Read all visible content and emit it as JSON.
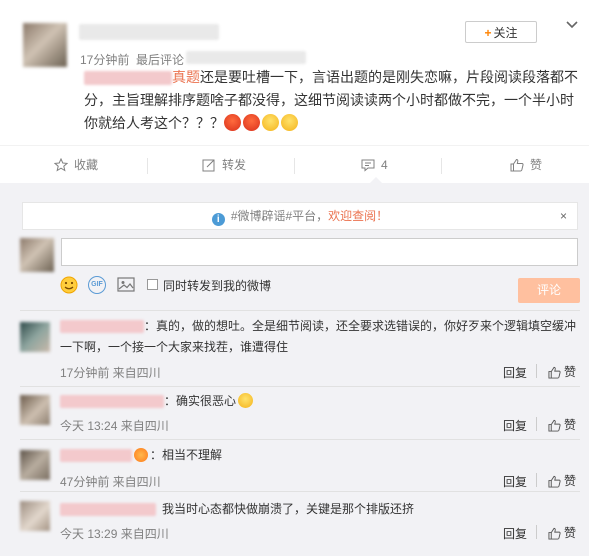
{
  "post": {
    "time_text": "17分钟前",
    "source_prefix": "最后评论",
    "follow_label": "关注",
    "text_link": "真题",
    "text_main": "还是要吐槽一下，言语出题的是刚失恋嘛，片段阅读段落都不分，主旨理解排序题啥子都没得，这细节阅读读两个小时都做不完，一个半小时你就给人考这个？？？",
    "actions": {
      "collect": "收藏",
      "repost": "转发",
      "comment_count": "4",
      "like": "赞"
    }
  },
  "notice": {
    "tag_text": "#微博辟谣#平台，",
    "highlight_text": "欢迎查阅！",
    "close_label": "×"
  },
  "composer": {
    "input_value": "",
    "repost_checkbox_label": "同时转发到我的微博",
    "submit_label": "评论",
    "gif_label": "GIF"
  },
  "comments": [
    {
      "text": "：真的，做的想吐。全是细节阅读，还全要求选错误的，你好歹来个逻辑填空缓冲一下啊，一个接一个大家来找茬，谁遭得住",
      "meta": "17分钟前 来自四川",
      "reply": "回复",
      "like": "赞"
    },
    {
      "text": "：确实很恶心",
      "meta": "今天 13:24 来自四川",
      "reply": "回复",
      "like": "赞"
    },
    {
      "text": "：相当不理解",
      "meta": "47分钟前 来自四川",
      "reply": "回复",
      "like": "赞"
    },
    {
      "text": "我当时心态都快做崩溃了，关键是那个排版还挤",
      "meta": "今天 13:29 来自四川",
      "reply": "回复",
      "like": "赞"
    }
  ],
  "colors": {
    "accent": "#eb7350",
    "follow_plus": "#ff8200",
    "submit_bg": "#ffc09f",
    "comment_bg": "#f2f2f5"
  }
}
